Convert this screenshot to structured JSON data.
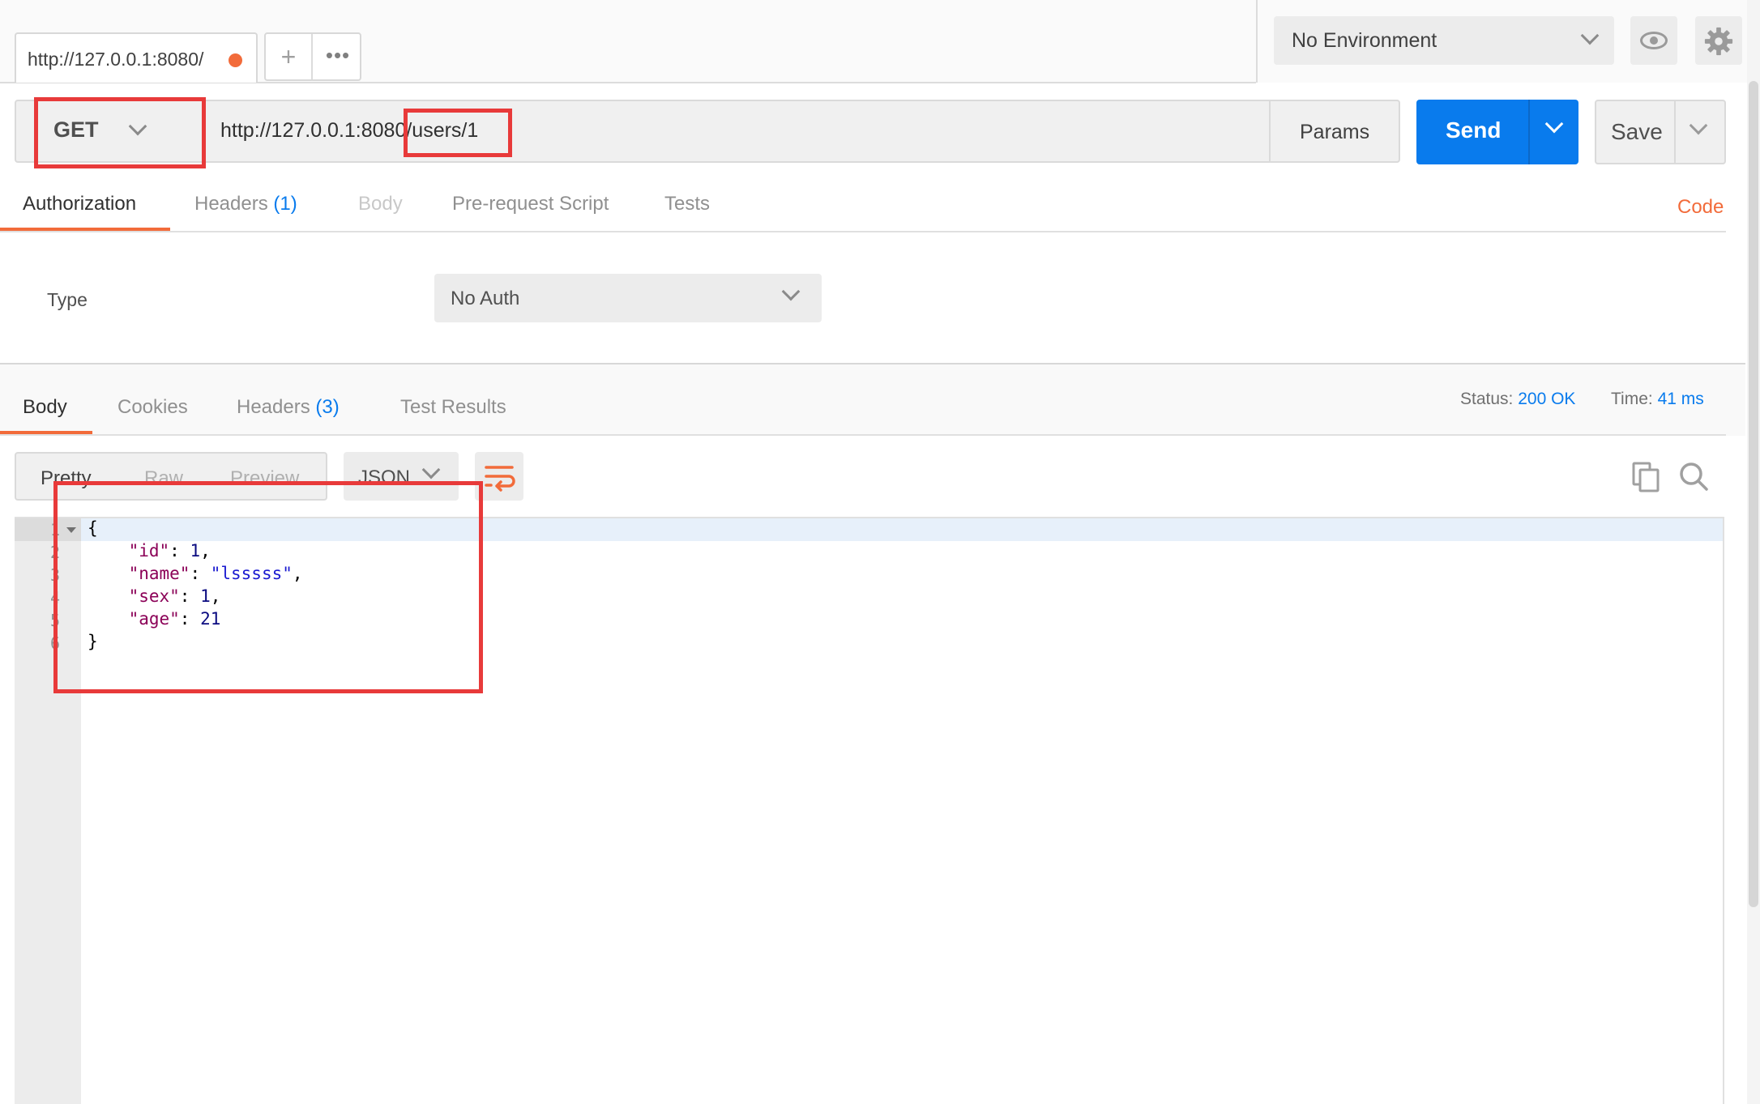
{
  "request_tab": {
    "title": "http://127.0.0.1:8080/",
    "unsaved": true
  },
  "tab_buttons": {
    "plus": "+",
    "more": "•••"
  },
  "environment": {
    "selected": "No Environment"
  },
  "request": {
    "method": "GET",
    "url": "http://127.0.0.1:8080/users/1",
    "params_label": "Params",
    "send_label": "Send",
    "save_label": "Save"
  },
  "request_tabs": [
    {
      "label": "Authorization",
      "count": "",
      "state": "active"
    },
    {
      "label": "Headers",
      "count": "(1)",
      "state": "normal"
    },
    {
      "label": "Body",
      "count": "",
      "state": "disabled"
    },
    {
      "label": "Pre-request Script",
      "count": "",
      "state": "normal"
    },
    {
      "label": "Tests",
      "count": "",
      "state": "normal"
    }
  ],
  "code_link": "Code",
  "auth": {
    "type_label": "Type",
    "type_value": "No Auth"
  },
  "response_tabs": [
    {
      "label": "Body",
      "count": "",
      "state": "active"
    },
    {
      "label": "Cookies",
      "count": "",
      "state": "normal"
    },
    {
      "label": "Headers",
      "count": "(3)",
      "state": "normal"
    },
    {
      "label": "Test Results",
      "count": "",
      "state": "normal"
    }
  ],
  "response_meta": {
    "status_label": "Status:",
    "status_value": "200 OK",
    "time_label": "Time:",
    "time_value": "41 ms"
  },
  "view_options": {
    "pretty": "Pretty",
    "raw": "Raw",
    "preview": "Preview",
    "format": "JSON"
  },
  "response_body": {
    "line_numbers": [
      "1",
      "2",
      "3",
      "4",
      "5",
      "6"
    ],
    "lines": [
      [
        {
          "t": "{",
          "c": ""
        }
      ],
      [
        {
          "t": "    ",
          "c": ""
        },
        {
          "t": "\"id\"",
          "c": "k"
        },
        {
          "t": ": ",
          "c": ""
        },
        {
          "t": "1",
          "c": "n"
        },
        {
          "t": ",",
          "c": ""
        }
      ],
      [
        {
          "t": "    ",
          "c": ""
        },
        {
          "t": "\"name\"",
          "c": "k"
        },
        {
          "t": ": ",
          "c": ""
        },
        {
          "t": "\"lsssss\"",
          "c": "s"
        },
        {
          "t": ",",
          "c": ""
        }
      ],
      [
        {
          "t": "    ",
          "c": ""
        },
        {
          "t": "\"sex\"",
          "c": "k"
        },
        {
          "t": ": ",
          "c": ""
        },
        {
          "t": "1",
          "c": "n"
        },
        {
          "t": ",",
          "c": ""
        }
      ],
      [
        {
          "t": "    ",
          "c": ""
        },
        {
          "t": "\"age\"",
          "c": "k"
        },
        {
          "t": ": ",
          "c": ""
        },
        {
          "t": "21",
          "c": "n"
        }
      ],
      [
        {
          "t": "}",
          "c": ""
        }
      ]
    ]
  },
  "colors": {
    "accent": "#f26b3a",
    "primary": "#097bed",
    "annotation": "#e83a3a"
  },
  "icons": [
    "close-unsaved-dot-icon",
    "eye-icon",
    "gear-icon",
    "chevron-down-icon",
    "wrap-lines-icon",
    "copy-icon",
    "search-icon",
    "fold-arrow-icon"
  ]
}
